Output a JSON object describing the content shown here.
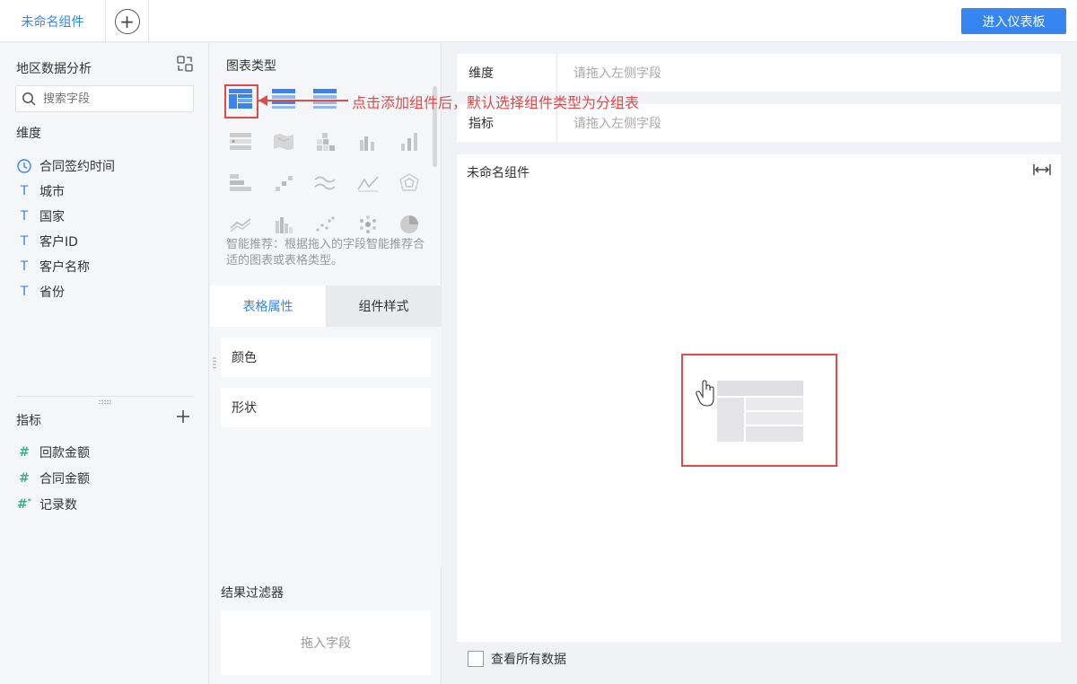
{
  "topbar": {
    "active_tab": "未命名组件",
    "add_tab_icon": "plus-circle-icon",
    "enter_dashboard": "进入仪表板"
  },
  "left": {
    "title": "地区数据分析",
    "switch_icon": "switch-dataset-icon",
    "search_placeholder": "搜索字段",
    "dimension_label": "维度",
    "dimensions": [
      {
        "icon": "clock-icon",
        "label": "合同签约时间"
      },
      {
        "icon": "text-type-icon",
        "label": "城市"
      },
      {
        "icon": "text-type-icon",
        "label": "国家"
      },
      {
        "icon": "text-type-icon",
        "label": "客户ID"
      },
      {
        "icon": "text-type-icon",
        "label": "客户名称"
      },
      {
        "icon": "text-type-icon",
        "label": "省份"
      }
    ],
    "measure_label": "指标",
    "measures": [
      {
        "icon": "number-type-icon",
        "label": "回款金额"
      },
      {
        "icon": "number-type-icon",
        "label": "合同金额"
      },
      {
        "icon": "record-count-icon",
        "label": "记录数"
      }
    ]
  },
  "middle": {
    "chart_type_title": "图表类型",
    "hint": "智能推荐：根据拖入的字段智能推荐合适的图表或表格类型。",
    "tab_table_props": "表格属性",
    "tab_component_style": "组件样式",
    "prop_color": "颜色",
    "prop_shape": "形状",
    "filter_title": "结果过滤器",
    "filter_placeholder": "拖入字段"
  },
  "right": {
    "dimension_label": "维度",
    "dimension_placeholder": "请拖入左侧字段",
    "measure_label": "指标",
    "measure_placeholder": "请拖入左侧字段",
    "component_name": "未命名组件",
    "view_all_data": "查看所有数据"
  },
  "annotation": {
    "text": "点击添加组件后，默认选择组件类型为分组表"
  },
  "colors": {
    "accent": "#3685f2",
    "annotation": "#e24a4a"
  }
}
